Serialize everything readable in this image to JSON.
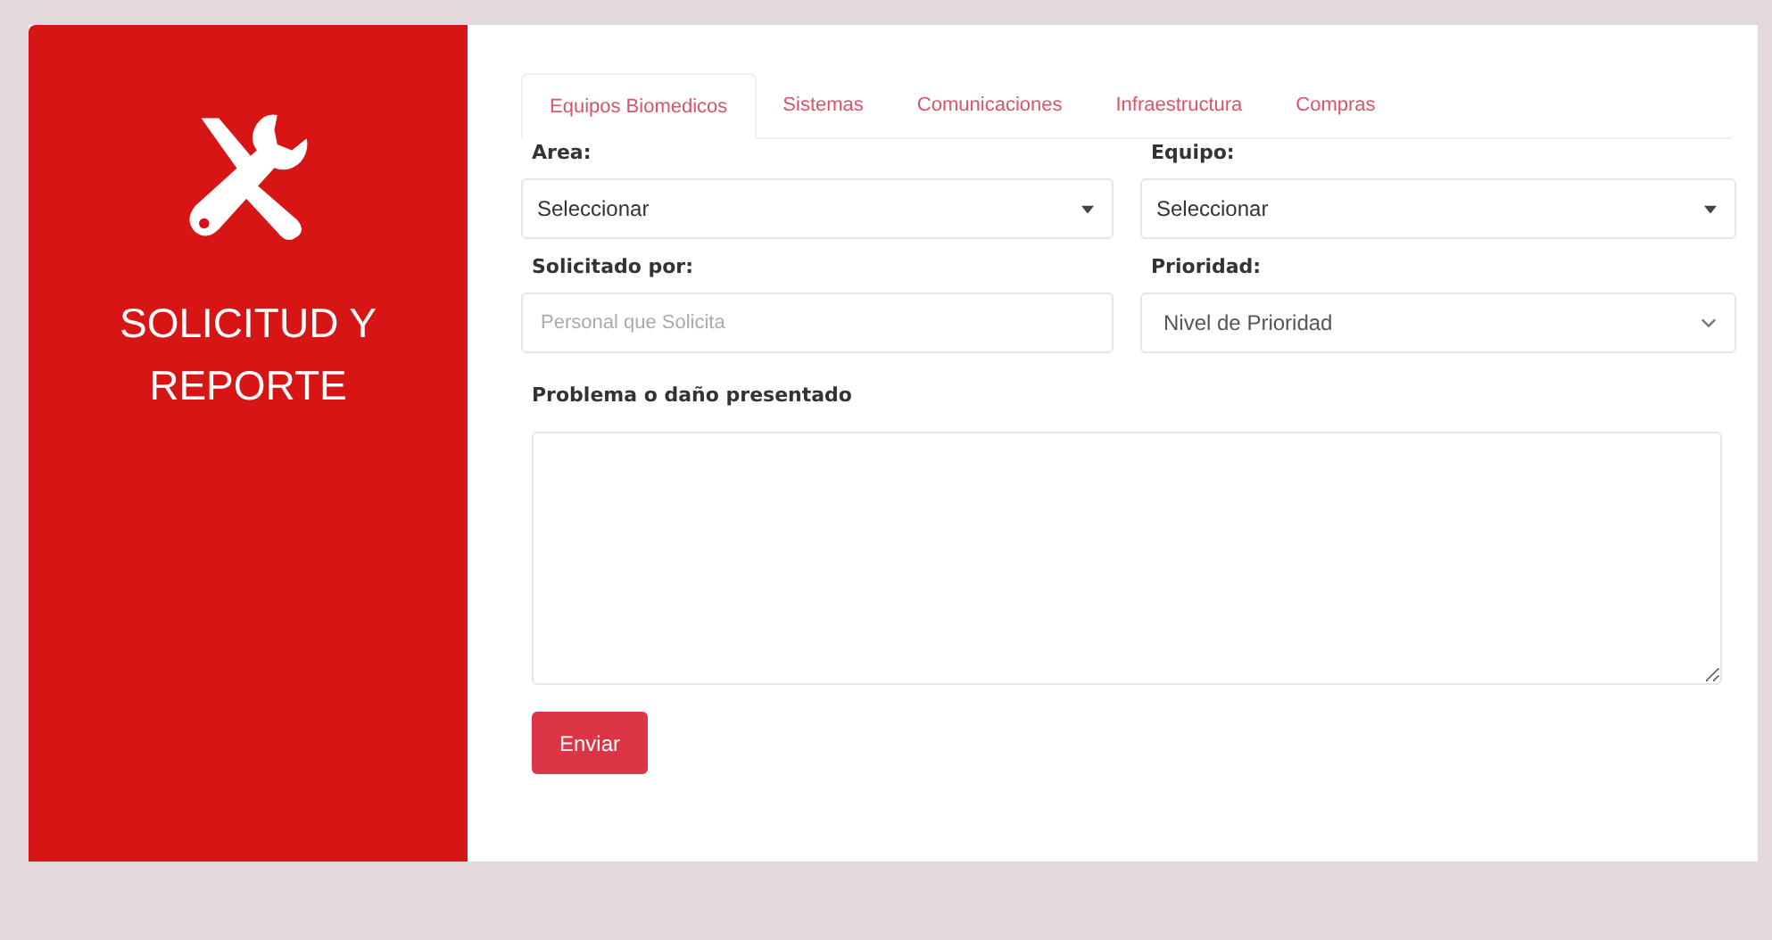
{
  "sidebar": {
    "title": "SOLICITUD Y REPORTE"
  },
  "tabs": [
    {
      "label": "Equipos Biomedicos",
      "selected": true
    },
    {
      "label": "Sistemas",
      "selected": false
    },
    {
      "label": "Comunicaciones",
      "selected": false
    },
    {
      "label": "Infraestructura",
      "selected": false
    },
    {
      "label": "Compras",
      "selected": false
    }
  ],
  "fields": [
    {
      "kind": "select",
      "label": "Area:",
      "value": "Seleccionar"
    },
    {
      "kind": "select",
      "label": "Equipo:",
      "value": "Seleccionar"
    },
    {
      "kind": "input",
      "label": "Solicitado por:",
      "placeholder": "Personal que Solicita"
    },
    {
      "kind": "dropdown",
      "label": "Prioridad:",
      "placeholder": "Nivel de Prioridad"
    }
  ],
  "problem": {
    "label": "Problema o daño presentado"
  },
  "submit": {
    "label": "Enviar"
  }
}
